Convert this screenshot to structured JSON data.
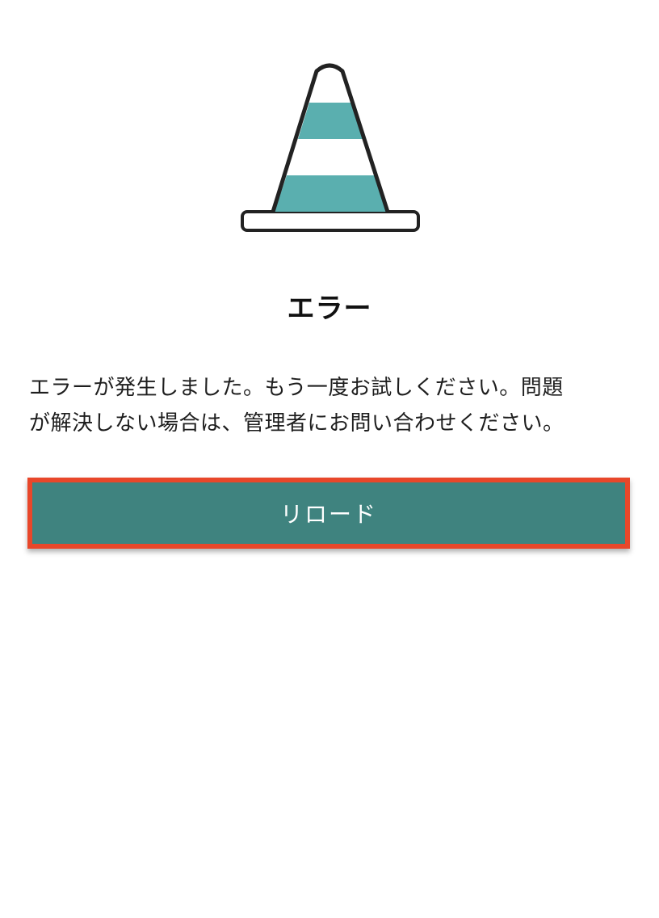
{
  "illustration": {
    "icon": "traffic-cone-icon",
    "stripe_color": "#5aafaf",
    "outline_color": "#222222"
  },
  "error": {
    "title": "エラー",
    "message_line1": "エラーが発生しました。もう一度お試しください。問題",
    "message_line2": "が解決しない場合は、管理者にお問い合わせください。"
  },
  "actions": {
    "reload_label": "リロード",
    "button_color": "#3f837f",
    "highlight_color": "#e8472a"
  }
}
